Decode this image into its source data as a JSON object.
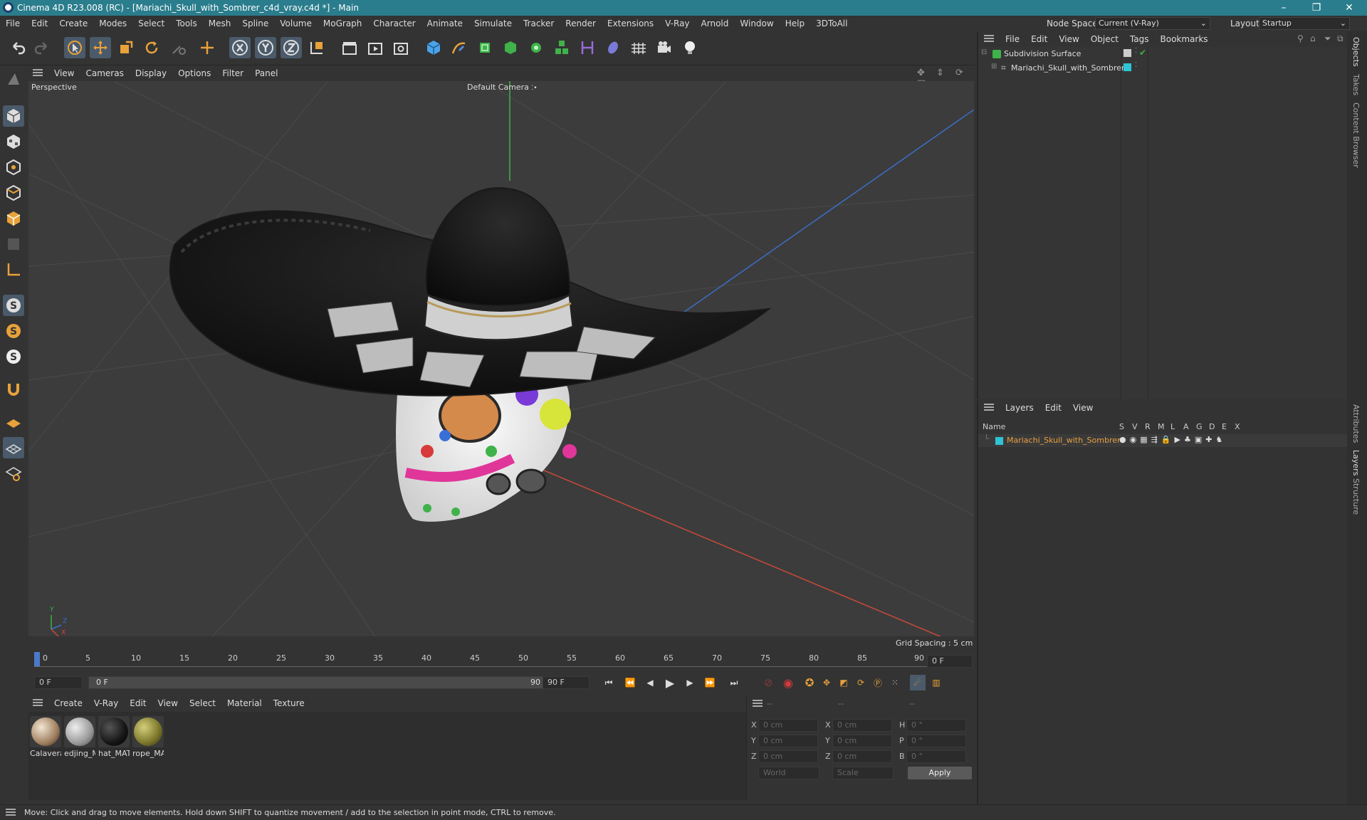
{
  "window": {
    "title": "Cinema 4D R23.008 (RC) - [Mariachi_Skull_with_Sombrer_c4d_vray.c4d *] - Main",
    "controls": [
      "–",
      "❐",
      "✕"
    ]
  },
  "menubar": {
    "items": [
      "File",
      "Edit",
      "Create",
      "Modes",
      "Select",
      "Tools",
      "Mesh",
      "Spline",
      "Volume",
      "MoGraph",
      "Character",
      "Animate",
      "Simulate",
      "Tracker",
      "Render",
      "Extensions",
      "V-Ray",
      "Arnold",
      "Window",
      "Help",
      "3DToAll"
    ],
    "node_space_label": "Node Space:",
    "node_space_value": "Current (V-Ray)",
    "layout_label": "Layout:",
    "layout_value": "Startup"
  },
  "viewport": {
    "menu": [
      "View",
      "Cameras",
      "Display",
      "Options",
      "Filter",
      "Panel"
    ],
    "name": "Perspective",
    "camera": "Default Camera",
    "grid_spacing": "Grid Spacing : 5 cm",
    "axes": {
      "y": "Y",
      "z": "Z",
      "x": "X"
    }
  },
  "timeline": {
    "ticks": [
      "0",
      "5",
      "10",
      "15",
      "20",
      "25",
      "30",
      "35",
      "40",
      "45",
      "50",
      "55",
      "60",
      "65",
      "70",
      "75",
      "80",
      "85",
      "90"
    ],
    "current_frame": "0 F"
  },
  "transport": {
    "start_field": "0 F",
    "range_start": "0 F",
    "range_end": "90 F",
    "end_field": "90 F"
  },
  "materials": {
    "menu": [
      "Create",
      "V-Ray",
      "Edit",
      "View",
      "Select",
      "Material",
      "Texture"
    ],
    "items": [
      {
        "name": "Calavera",
        "color": "#c9b9a4"
      },
      {
        "name": "edjing_M",
        "color": "#b8b8b8"
      },
      {
        "name": "hat_MAT",
        "color": "#161616"
      },
      {
        "name": "rope_MA",
        "color": "#8f8a3a"
      }
    ]
  },
  "coords": {
    "header": [
      "--",
      "--",
      "--"
    ],
    "rows": [
      {
        "l1": "X",
        "v1": "0 cm",
        "l2": "X",
        "v2": "0 cm",
        "l3": "H",
        "v3": "0 °"
      },
      {
        "l1": "Y",
        "v1": "0 cm",
        "l2": "Y",
        "v2": "0 cm",
        "l3": "P",
        "v3": "0 °"
      },
      {
        "l1": "Z",
        "v1": "0 cm",
        "l2": "Z",
        "v2": "0 cm",
        "l3": "B",
        "v3": "0 °"
      }
    ],
    "space": "World",
    "mode": "Scale",
    "apply": "Apply"
  },
  "objects": {
    "menu": [
      "File",
      "Edit",
      "View",
      "Object",
      "Tags",
      "Bookmarks"
    ],
    "tree": [
      {
        "name": "Subdivision Surface"
      },
      {
        "name": "Mariachi_Skull_with_Sombrero"
      }
    ]
  },
  "layers": {
    "menu": [
      "Layers",
      "Edit",
      "View"
    ],
    "columns": {
      "name": "Name",
      "flags": [
        "S",
        "V",
        "R",
        "M",
        "L",
        "A",
        "G",
        "D",
        "E",
        "X"
      ]
    },
    "rows": [
      {
        "name": "Mariachi_Skull_with_Sombrer",
        "color": "#2fc4d4"
      }
    ]
  },
  "side_tabs": [
    "Objects",
    "Takes",
    "Content Browser",
    "Attributes",
    "Layers",
    "Structure"
  ],
  "status": "Move: Click and drag to move elements. Hold down SHIFT to quantize movement / add to the selection in point mode, CTRL to remove.",
  "colors": {
    "accent": "#2a7d8c",
    "layer_name": "#e8a040",
    "x_axis": "#c84a3a",
    "y_axis": "#3fb24a",
    "z_axis": "#3a6fc8"
  }
}
